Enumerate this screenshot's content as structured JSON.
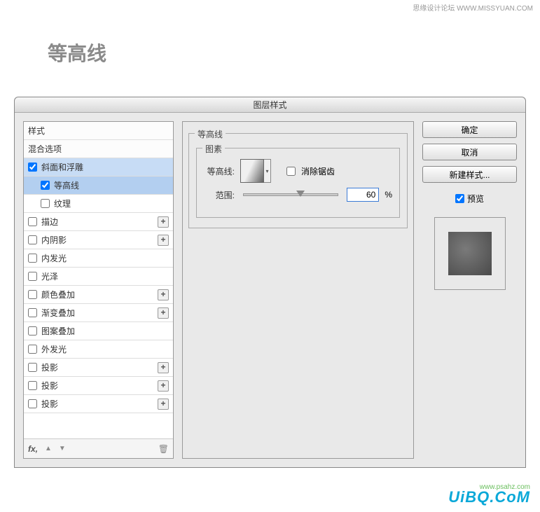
{
  "watermark_top": "思缘设计论坛  WWW.MISSYUAN.COM",
  "heading": "等高线",
  "dialog_title": "图层样式",
  "styles": {
    "header1": "样式",
    "header2": "混合选项",
    "bevel": {
      "label": "斜面和浮雕",
      "checked": true
    },
    "contour_sub": {
      "label": "等高线",
      "checked": true
    },
    "texture_sub": {
      "label": "纹理",
      "checked": false
    },
    "stroke": {
      "label": "描边",
      "checked": false
    },
    "inner_shadow": {
      "label": "内阴影",
      "checked": false
    },
    "inner_glow": {
      "label": "内发光",
      "checked": false
    },
    "satin": {
      "label": "光泽",
      "checked": false
    },
    "color_overlay": {
      "label": "颜色叠加",
      "checked": false
    },
    "gradient_overlay": {
      "label": "渐变叠加",
      "checked": false
    },
    "pattern_overlay": {
      "label": "图案叠加",
      "checked": false
    },
    "outer_glow": {
      "label": "外发光",
      "checked": false
    },
    "drop_shadow1": {
      "label": "投影",
      "checked": false
    },
    "drop_shadow2": {
      "label": "投影",
      "checked": false
    },
    "drop_shadow3": {
      "label": "投影",
      "checked": false
    }
  },
  "footer": {
    "fx": "fx,"
  },
  "middle": {
    "group_label": "等高线",
    "inner_label": "图素",
    "contour_label": "等高线:",
    "antialias_label": "消除锯齿",
    "range_label": "范围:",
    "range_value": "60",
    "percent": "%"
  },
  "buttons": {
    "ok": "确定",
    "cancel": "取消",
    "new_style": "新建样式...",
    "preview": "预览"
  },
  "watermark_bottom": "UiBQ.CoM",
  "watermark_psahz": "www.psahz.com"
}
